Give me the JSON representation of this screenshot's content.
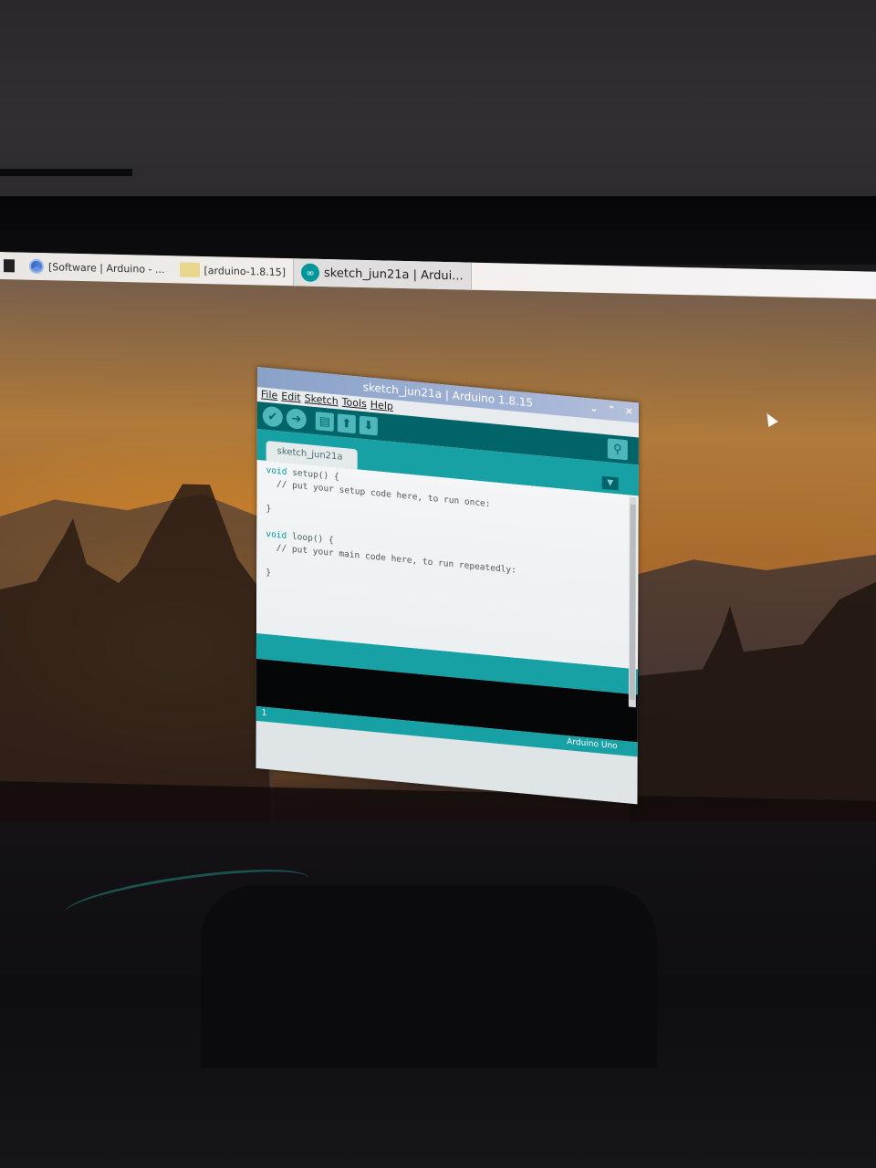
{
  "taskbar": {
    "tasks": [
      {
        "icon": "terminal-icon",
        "label": ""
      },
      {
        "icon": "chromium-icon",
        "label": "[Software | Arduino - ..."
      },
      {
        "icon": "folder-icon",
        "label": "[arduino-1.8.15]"
      },
      {
        "icon": "arduino-icon",
        "label": "sketch_jun21a | Ardui..."
      }
    ]
  },
  "window": {
    "title": "sketch_jun21a | Arduino 1.8.15",
    "controls": {
      "minimize": "⌄",
      "maximize": "⌃",
      "close": "✕"
    },
    "menu": [
      "File",
      "Edit",
      "Sketch",
      "Tools",
      "Help"
    ],
    "toolbar": [
      {
        "name": "verify-button",
        "glyph": "✔"
      },
      {
        "name": "upload-button",
        "glyph": "➔"
      },
      {
        "name": "new-button",
        "glyph": "▤"
      },
      {
        "name": "open-button",
        "glyph": "⬆"
      },
      {
        "name": "save-button",
        "glyph": "⬇"
      }
    ],
    "serial_monitor_glyph": "⚲",
    "tab_label": "sketch_jun21a",
    "tab_menu_glyph": "▼",
    "code": [
      {
        "kw": "void",
        "rest": " setup() {"
      },
      {
        "kw": "",
        "rest": "  // put your setup code here, to run once:"
      },
      {
        "kw": "",
        "rest": ""
      },
      {
        "kw": "",
        "rest": "}"
      },
      {
        "kw": "",
        "rest": ""
      },
      {
        "kw": "void",
        "rest": " loop() {"
      },
      {
        "kw": "",
        "rest": "  // put your main code here, to run repeatedly:"
      },
      {
        "kw": "",
        "rest": ""
      },
      {
        "kw": "",
        "rest": "}"
      }
    ],
    "line_number": "1",
    "board": "Arduino Uno"
  },
  "colors": {
    "arduino_dark_teal": "#006468",
    "arduino_teal": "#17a1a5",
    "keyword": "#00979c"
  }
}
